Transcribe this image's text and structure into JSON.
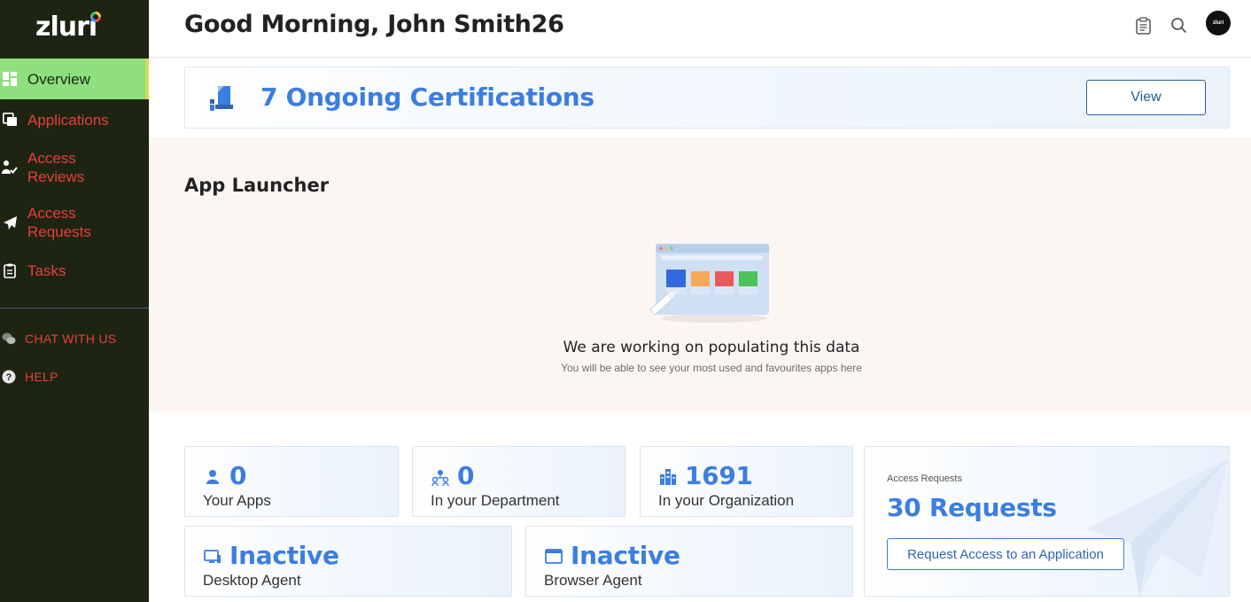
{
  "sidebar": {
    "logo": "zluri",
    "nav": [
      {
        "label": "Overview",
        "icon": "overview-grid-icon",
        "active": true
      },
      {
        "label": "Applications",
        "icon": "applications-icon",
        "active": false
      },
      {
        "label": "Access Reviews",
        "icon": "access-reviews-icon",
        "active": false
      },
      {
        "label": "Access Requests",
        "icon": "paper-plane-icon",
        "active": false
      },
      {
        "label": "Tasks",
        "icon": "clipboard-icon",
        "active": false
      }
    ],
    "utility": [
      {
        "label": "CHAT WITH US",
        "icon": "chat-icon"
      },
      {
        "label": "HELP",
        "icon": "help-icon"
      }
    ]
  },
  "header": {
    "greeting": "Good Morning, John Smith26",
    "avatar_text": "zluri",
    "icons": [
      "clipboard-icon",
      "search-icon"
    ]
  },
  "certifications": {
    "title": "7 Ongoing Certifications",
    "button": "View",
    "icon": "certification-icon"
  },
  "launcher": {
    "title": "App Launcher",
    "empty_title": "We are working on populating this data",
    "empty_subtitle": "You will be able to see your most used and favourites apps here"
  },
  "stats": [
    {
      "value": "0",
      "label": "Your Apps",
      "icon": "user-icon"
    },
    {
      "value": "0",
      "label": "In your Department",
      "icon": "department-icon"
    },
    {
      "value": "1691",
      "label": "In your Organization",
      "icon": "organization-icon"
    },
    {
      "value": "Inactive",
      "label": "Desktop Agent",
      "icon": "desktop-icon"
    },
    {
      "value": "Inactive",
      "label": "Browser Agent",
      "icon": "browser-icon"
    }
  ],
  "access_requests": {
    "label": "Access Requests",
    "count": "30 Requests",
    "button": "Request Access to an Application"
  },
  "colors": {
    "sidebar_bg": "#1d2412",
    "active_bg": "#8ee07f",
    "nav_text": "#e8403a",
    "accent_blue": "#3b7ee0",
    "launcher_bg": "#fcf6f3"
  }
}
